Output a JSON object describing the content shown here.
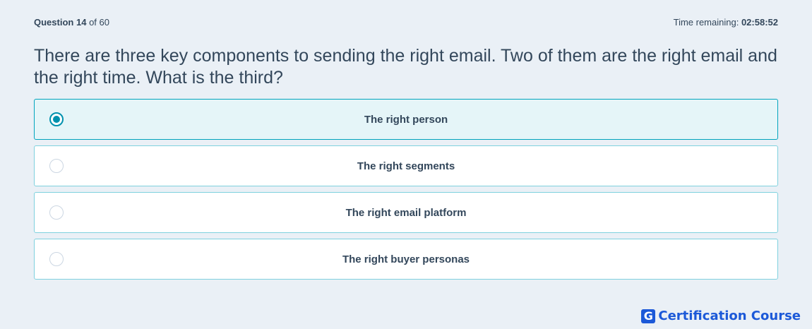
{
  "header": {
    "question_label": "Question",
    "question_number": "14",
    "of_label": "of 60",
    "time_label": "Time remaining:",
    "time_value": "02:58:52"
  },
  "question": {
    "text": "There are three key components to sending the right email. Two of them are the right email and the right time. What is the third?"
  },
  "options": [
    {
      "label": "The right person",
      "selected": true
    },
    {
      "label": "The right segments",
      "selected": false
    },
    {
      "label": "The right email platform",
      "selected": false
    },
    {
      "label": "The right buyer personas",
      "selected": false
    }
  ],
  "brand": {
    "logo_letter": "G",
    "name": "Certification Course",
    "color": "#1c59d8"
  },
  "colors": {
    "background": "#eaf0f6",
    "selected_bg": "#e5f5f8",
    "accent": "#0091ae"
  }
}
